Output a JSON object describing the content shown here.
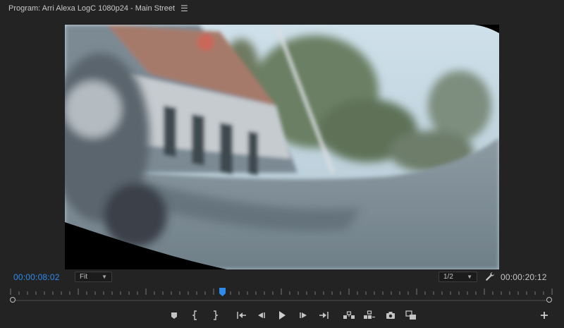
{
  "header": {
    "title": "Program: Arri Alexa LogC 1080p24 - Main Street",
    "menu_icon": "hamburger-menu-icon"
  },
  "timecode": {
    "current": "00:00:08:02",
    "duration": "00:00:20:12"
  },
  "zoom_select": {
    "value": "Fit"
  },
  "resolution_select": {
    "value": "1/2"
  },
  "playhead_fraction": 0.39,
  "colors": {
    "accent_blue": "#2d8ceb",
    "panel_bg": "#232323",
    "icon_gray": "#c4c4c4"
  },
  "transport_buttons": [
    "add-marker-icon",
    "mark-in-icon",
    "mark-out-icon",
    "go-to-in-icon",
    "step-back-icon",
    "play-icon",
    "step-forward-icon",
    "go-to-out-icon",
    "lift-icon",
    "extract-icon",
    "export-frame-camera-icon",
    "comparison-view-icon",
    "add-button-plus-icon"
  ]
}
